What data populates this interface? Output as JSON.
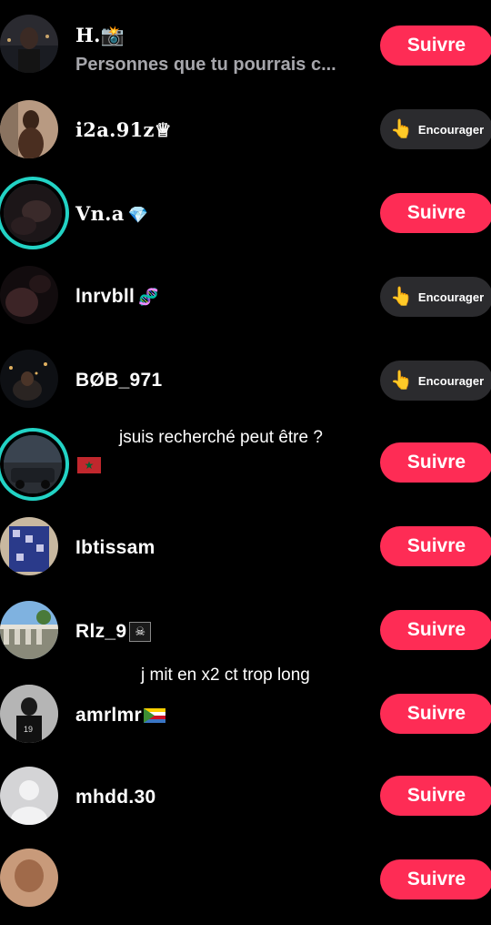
{
  "rows": [
    {
      "name": "H.📸",
      "subtitle": "Personnes que tu pourrais c...",
      "action": "Suivre"
    },
    {
      "name": "i2a.91z♕",
      "action": "Encourager"
    },
    {
      "name": "Vn.a",
      "name_icon": "💎",
      "action": "Suivre"
    },
    {
      "name": "lnrvbll",
      "name_icon": "🧬",
      "action": "Encourager"
    },
    {
      "name": "BØB_971",
      "action": "Encourager"
    },
    {
      "name": "",
      "action": "Suivre"
    },
    {
      "name": "Ibtissam",
      "action": "Suivre"
    },
    {
      "name": "Rlz_9",
      "name_icon": "☠",
      "action": "Suivre"
    },
    {
      "name": "amrlmr",
      "action": "Suivre"
    },
    {
      "name": "mhdd.30",
      "action": "Suivre"
    },
    {
      "name": "",
      "action": "Suivre"
    }
  ],
  "captions": {
    "first": "jsuis recherché peut être ?",
    "second": "j mit en x2 ct trop long"
  },
  "icons": {
    "cheer": "👆",
    "flag_morocco": "★"
  },
  "colors": {
    "follow": "#fe2c55",
    "cheer_bg": "#2b2b2e",
    "story_ring": "#22d3c5"
  }
}
